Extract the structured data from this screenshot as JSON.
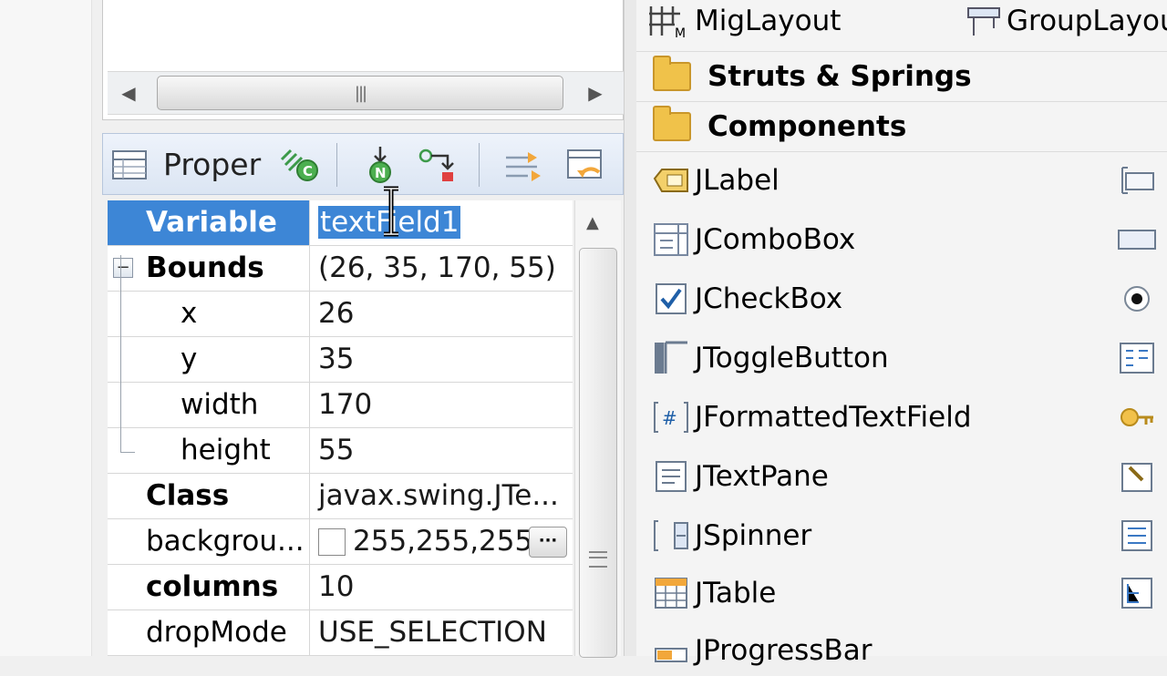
{
  "toolbar": {
    "title": "Proper"
  },
  "properties": [
    {
      "name": "Variable",
      "value": "textField1",
      "selected": true
    },
    {
      "name": "Bounds",
      "value": "(26, 35, 170, 55)",
      "expander": "−",
      "bold": true
    },
    {
      "name": "x",
      "value": "26"
    },
    {
      "name": "y",
      "value": "35"
    },
    {
      "name": "width",
      "value": "170"
    },
    {
      "name": "height",
      "value": "55"
    },
    {
      "name": "Class",
      "value": "javax.swing.JTe...",
      "bold": true
    },
    {
      "name": "backgrou...",
      "value": "255,255,255",
      "has_swatch": true,
      "swatch_color": "#ffffff",
      "button": "···"
    },
    {
      "name": "columns",
      "value": "10",
      "bold": true
    },
    {
      "name": "dropMode",
      "value": "USE_SELECTION"
    }
  ],
  "palette": {
    "top_items": [
      "MigLayout",
      "GroupLayou"
    ],
    "categories": [
      "Struts & Springs",
      "Components"
    ],
    "items": [
      "JLabel",
      "JComboBox",
      "JCheckBox",
      "JToggleButton",
      "JFormattedTextField",
      "JTextPane",
      "JSpinner",
      "JTable",
      "JProgressBar"
    ]
  },
  "colors": {
    "selection": "#3d86d6",
    "toolbar_bg": "#dbe5f3"
  }
}
